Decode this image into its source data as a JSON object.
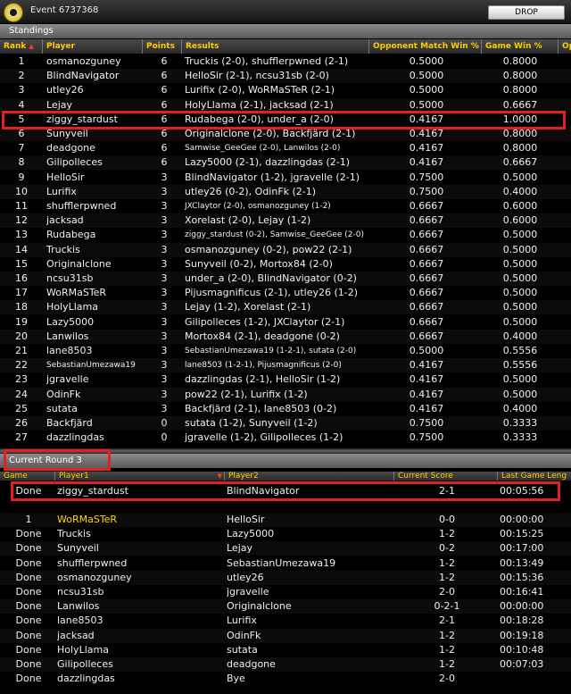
{
  "window": {
    "event_title": "Event 6737368",
    "drop_label": "DROP"
  },
  "standings": {
    "section_label": "Standings",
    "headers": [
      "Rank",
      "Player",
      "Points",
      "Results",
      "Opponent Match Win %",
      "Game Win %",
      "Op"
    ],
    "rows": [
      {
        "rank": "1",
        "player": "osmanozguney",
        "points": "6",
        "results": "Truckis (2-0), shufflerpwned (2-1)",
        "omw": "0.5000",
        "gw": "0.8000"
      },
      {
        "rank": "2",
        "player": "BlindNavigator",
        "points": "6",
        "results": "HelloSir (2-1), ncsu31sb (2-0)",
        "omw": "0.5000",
        "gw": "0.8000"
      },
      {
        "rank": "3",
        "player": "utley26",
        "points": "6",
        "results": "Lurifix (2-0), WoRMaSTeR (2-1)",
        "omw": "0.5000",
        "gw": "0.8000"
      },
      {
        "rank": "4",
        "player": "Lejay",
        "points": "6",
        "results": "HolyLlama (2-1), jacksad (2-1)",
        "omw": "0.5000",
        "gw": "0.6667"
      },
      {
        "rank": "5",
        "player": "ziggy_stardust",
        "points": "6",
        "results": "Rudabega (2-0), under_a (2-0)",
        "omw": "0.4167",
        "gw": "1.0000"
      },
      {
        "rank": "6",
        "player": "Sunyveil",
        "points": "6",
        "results": "Originalclone (2-0), Backfjärd (2-1)",
        "omw": "0.4167",
        "gw": "0.8000"
      },
      {
        "rank": "7",
        "player": "deadgone",
        "points": "6",
        "results": "Samwise_GeeGee (2-0), Lanwilos (2-0)",
        "omw": "0.4167",
        "gw": "0.8000",
        "small": true
      },
      {
        "rank": "8",
        "player": "Gilipolleces",
        "points": "6",
        "results": "Lazy5000 (2-1), dazzlingdas (2-1)",
        "omw": "0.4167",
        "gw": "0.6667"
      },
      {
        "rank": "9",
        "player": "HelloSir",
        "points": "3",
        "results": "BlindNavigator (1-2), jgravelle (2-1)",
        "omw": "0.7500",
        "gw": "0.5000"
      },
      {
        "rank": "10",
        "player": "Lurifix",
        "points": "3",
        "results": "utley26 (0-2), OdinFk (2-1)",
        "omw": "0.7500",
        "gw": "0.4000"
      },
      {
        "rank": "11",
        "player": "shufflerpwned",
        "points": "3",
        "results": "JXClaytor (2-0), osmanozguney (1-2)",
        "omw": "0.6667",
        "gw": "0.6000",
        "small": true
      },
      {
        "rank": "12",
        "player": "jacksad",
        "points": "3",
        "results": "Xorelast (2-0), Lejay (1-2)",
        "omw": "0.6667",
        "gw": "0.6000"
      },
      {
        "rank": "13",
        "player": "Rudabega",
        "points": "3",
        "results": "ziggy_stardust (0-2), Samwise_GeeGee (2-0)",
        "omw": "0.6667",
        "gw": "0.5000",
        "small": true
      },
      {
        "rank": "14",
        "player": "Truckis",
        "points": "3",
        "results": "osmanozguney (0-2), pow22 (2-1)",
        "omw": "0.6667",
        "gw": "0.5000"
      },
      {
        "rank": "15",
        "player": "Originalclone",
        "points": "3",
        "results": "Sunyveil (0-2), Mortox84 (2-0)",
        "omw": "0.6667",
        "gw": "0.5000"
      },
      {
        "rank": "16",
        "player": "ncsu31sb",
        "points": "3",
        "results": "under_a (2-0), BlindNavigator (0-2)",
        "omw": "0.6667",
        "gw": "0.5000"
      },
      {
        "rank": "17",
        "player": "WoRMaSTeR",
        "points": "3",
        "results": "Pijusmagnificus (2-1), utley26 (1-2)",
        "omw": "0.6667",
        "gw": "0.5000"
      },
      {
        "rank": "18",
        "player": "HolyLlama",
        "points": "3",
        "results": "Lejay (1-2), Xorelast (2-1)",
        "omw": "0.6667",
        "gw": "0.5000"
      },
      {
        "rank": "19",
        "player": "Lazy5000",
        "points": "3",
        "results": "Gilipolleces (1-2), JXClaytor (2-1)",
        "omw": "0.6667",
        "gw": "0.5000"
      },
      {
        "rank": "20",
        "player": "Lanwilos",
        "points": "3",
        "results": "Mortox84 (2-1), deadgone (0-2)",
        "omw": "0.6667",
        "gw": "0.4000"
      },
      {
        "rank": "21",
        "player": "lane8503",
        "points": "3",
        "results": "SebastianUmezawa19 (1-2-1), sutata (2-0)",
        "omw": "0.5000",
        "gw": "0.5556",
        "small": true
      },
      {
        "rank": "22",
        "player": "SebastianUmezawa19",
        "points": "3",
        "results": "lane8503 (1-2-1), Pijusmagnificus (2-0)",
        "omw": "0.4167",
        "gw": "0.5556",
        "small": true,
        "small_player": true
      },
      {
        "rank": "23",
        "player": "jgravelle",
        "points": "3",
        "results": "dazzlingdas (2-1), HelloSir (1-2)",
        "omw": "0.4167",
        "gw": "0.5000"
      },
      {
        "rank": "24",
        "player": "OdinFk",
        "points": "3",
        "results": "pow22 (2-1), Lurifix (1-2)",
        "omw": "0.4167",
        "gw": "0.5000"
      },
      {
        "rank": "25",
        "player": "sutata",
        "points": "3",
        "results": "Backfjärd (2-1), lane8503 (0-2)",
        "omw": "0.4167",
        "gw": "0.4000"
      },
      {
        "rank": "26",
        "player": "Backfjärd",
        "points": "0",
        "results": "sutata (1-2), Sunyveil (1-2)",
        "omw": "0.7500",
        "gw": "0.3333"
      },
      {
        "rank": "27",
        "player": "dazzlingdas",
        "points": "0",
        "results": "jgravelle (1-2), Gilipolleces (1-2)",
        "omw": "0.7500",
        "gw": "0.3333"
      }
    ]
  },
  "round": {
    "section_label": "Current Round 3",
    "headers": [
      "Game",
      "Player1",
      "Player2",
      "Current Score",
      "Last Game Leng"
    ],
    "rows": [
      {
        "game": "Done",
        "p1": "ziggy_stardust",
        "p2": "BlindNavigator",
        "score": "2-1",
        "time": "00:05:56"
      },
      {
        "game": "1",
        "p1": "WoRMaSTeR",
        "p2": "HelloSir",
        "score": "0-0",
        "time": "00:00:00",
        "active": true
      },
      {
        "game": "Done",
        "p1": "Truckis",
        "p2": "Lazy5000",
        "score": "1-2",
        "time": "00:15:25"
      },
      {
        "game": "Done",
        "p1": "Sunyveil",
        "p2": "Lejay",
        "score": "0-2",
        "time": "00:17:00"
      },
      {
        "game": "Done",
        "p1": "shufflerpwned",
        "p2": "SebastianUmezawa19",
        "score": "1-2",
        "time": "00:13:49"
      },
      {
        "game": "Done",
        "p1": "osmanozguney",
        "p2": "utley26",
        "score": "1-2",
        "time": "00:15:36"
      },
      {
        "game": "Done",
        "p1": "ncsu31sb",
        "p2": "jgravelle",
        "score": "2-0",
        "time": "00:16:41"
      },
      {
        "game": "Done",
        "p1": "Lanwilos",
        "p2": "Originalclone",
        "score": "0-2-1",
        "time": "00:00:00"
      },
      {
        "game": "Done",
        "p1": "lane8503",
        "p2": "Lurifix",
        "score": "2-1",
        "time": "00:18:28"
      },
      {
        "game": "Done",
        "p1": "jacksad",
        "p2": "OdinFk",
        "score": "1-2",
        "time": "00:19:18"
      },
      {
        "game": "Done",
        "p1": "HolyLlama",
        "p2": "sutata",
        "score": "1-2",
        "time": "00:10:48"
      },
      {
        "game": "Done",
        "p1": "Gilipolleces",
        "p2": "deadgone",
        "score": "1-2",
        "time": "00:07:03"
      },
      {
        "game": "Done",
        "p1": "dazzlingdas",
        "p2": "Bye",
        "score": "2-0",
        "time": ""
      }
    ]
  },
  "colors": {
    "highlight_box": "#e32020",
    "header_text": "#ffcc00",
    "active_player": "#ffd400"
  }
}
